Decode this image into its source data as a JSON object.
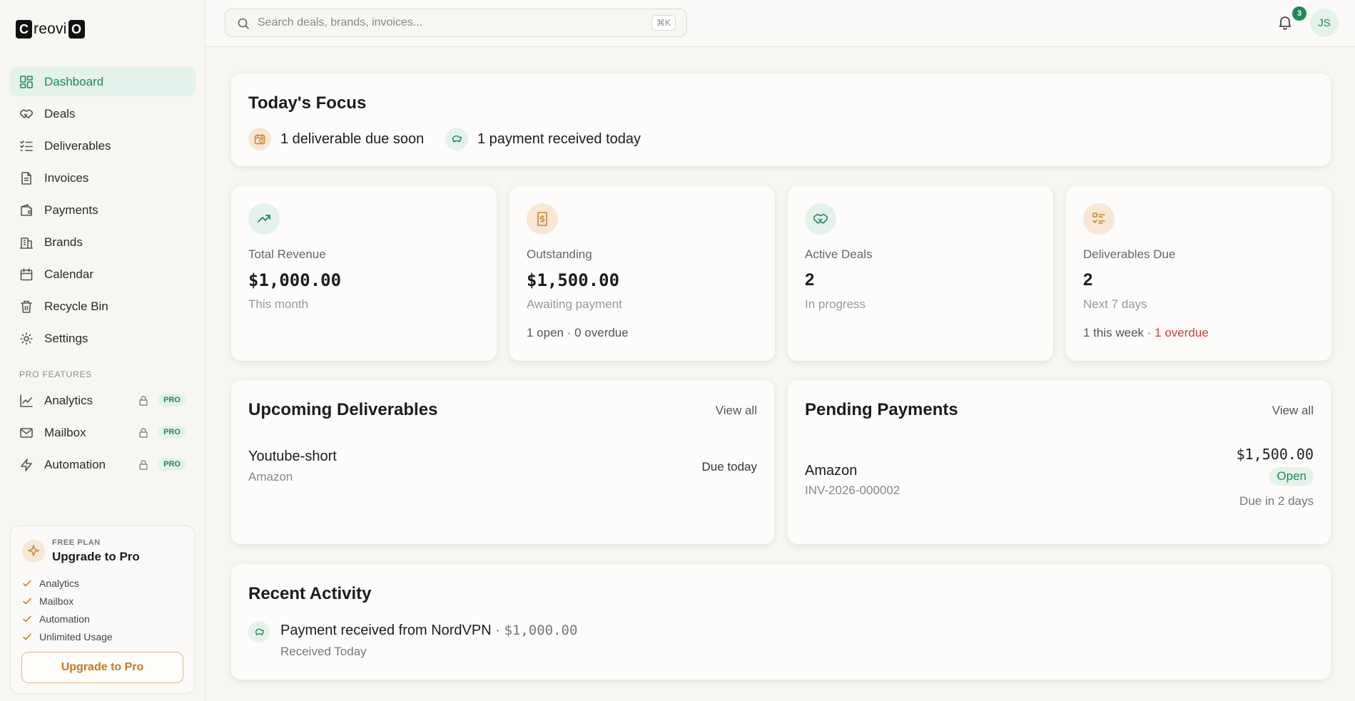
{
  "app": {
    "logo_left": "C",
    "logo_mid": "reovi",
    "logo_right": "O"
  },
  "sidebar": {
    "items": [
      {
        "label": "Dashboard",
        "icon": "dashboard-icon",
        "active": true
      },
      {
        "label": "Deals",
        "icon": "handshake-icon"
      },
      {
        "label": "Deliverables",
        "icon": "checklist-icon"
      },
      {
        "label": "Invoices",
        "icon": "document-icon"
      },
      {
        "label": "Payments",
        "icon": "wallet-icon"
      },
      {
        "label": "Brands",
        "icon": "building-icon"
      },
      {
        "label": "Calendar",
        "icon": "calendar-icon"
      },
      {
        "label": "Recycle Bin",
        "icon": "trash-icon"
      },
      {
        "label": "Settings",
        "icon": "gear-icon"
      }
    ],
    "pro_heading": "PRO FEATURES",
    "pro_items": [
      {
        "label": "Analytics",
        "badge": "PRO",
        "icon": "chart-line-icon"
      },
      {
        "label": "Mailbox",
        "badge": "PRO",
        "icon": "mail-icon"
      },
      {
        "label": "Automation",
        "badge": "PRO",
        "icon": "bolt-icon"
      }
    ],
    "upgrade": {
      "plan": "FREE PLAN",
      "title": "Upgrade to Pro",
      "features": [
        "Analytics",
        "Mailbox",
        "Automation",
        "Unlimited Usage"
      ],
      "button": "Upgrade to Pro"
    }
  },
  "topbar": {
    "search_placeholder": "Search deals, brands, invoices...",
    "shortcut": "⌘K",
    "notifications": "3",
    "avatar": "JS"
  },
  "focus": {
    "title": "Today's Focus",
    "items": [
      "1 deliverable due soon",
      "1 payment received today"
    ]
  },
  "stats": [
    {
      "label": "Total Revenue",
      "value": "$1,000.00",
      "sub": "This month",
      "icon": "trending-up-icon"
    },
    {
      "label": "Outstanding",
      "value": "$1,500.00",
      "sub": "Awaiting payment",
      "extra": "1 open · 0 overdue",
      "icon": "invoice-dollar-icon"
    },
    {
      "label": "Active Deals",
      "value": "2",
      "sub": "In progress",
      "icon": "handshake-icon"
    },
    {
      "label": "Deliverables Due",
      "value": "2",
      "sub": "Next 7 days",
      "extra_a": "1 this week · ",
      "extra_b": "1 overdue",
      "icon": "checklist-icon"
    }
  ],
  "upcoming": {
    "title": "Upcoming Deliverables",
    "view_all": "View all",
    "item": {
      "name": "Youtube-short",
      "brand": "Amazon",
      "due": "Due today"
    }
  },
  "pending": {
    "title": "Pending Payments",
    "view_all": "View all",
    "item": {
      "brand": "Amazon",
      "invoice": "INV-2026-000002",
      "amount": "$1,500.00",
      "status": "Open",
      "due": "Due in 2 days"
    }
  },
  "activity": {
    "title": "Recent Activity",
    "item": {
      "prefix": "Payment received from ",
      "brand": "NordVPN",
      "sep": " · ",
      "amount": "$1,000.00",
      "when": "Received Today"
    }
  },
  "colors": {
    "accent": "#1e8a58",
    "accent_bg": "#e3f2ea",
    "orange": "#c8862f",
    "orange_bg": "#f7e7d4",
    "danger": "#d23b3b"
  }
}
